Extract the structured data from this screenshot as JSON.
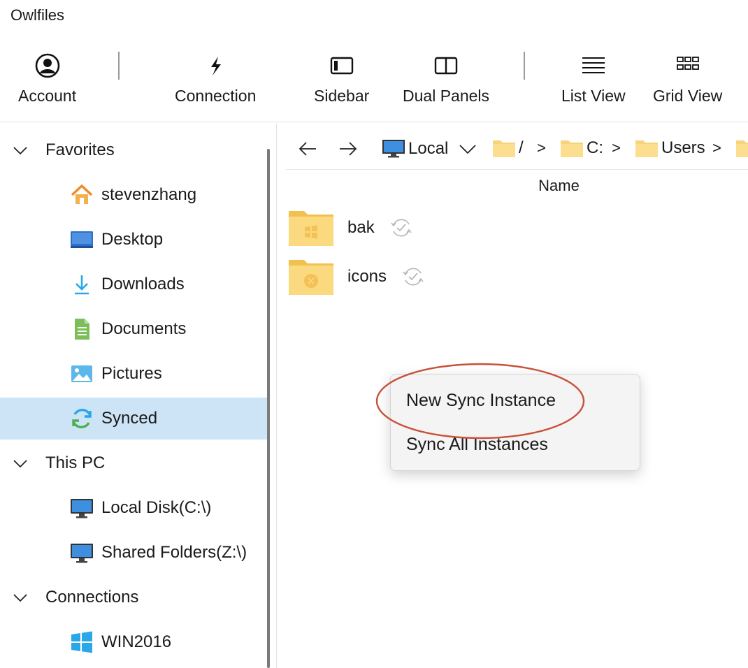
{
  "app": {
    "title": "Owlfiles"
  },
  "toolbar": {
    "account": "Account",
    "connection": "Connection",
    "sidebar": "Sidebar",
    "dual_panels": "Dual Panels",
    "list_view": "List View",
    "grid_view": "Grid View"
  },
  "sidebar": {
    "groups": [
      {
        "label": "Favorites",
        "items": [
          {
            "label": "stevenzhang",
            "icon": "home-icon"
          },
          {
            "label": "Desktop",
            "icon": "desktop-icon"
          },
          {
            "label": "Downloads",
            "icon": "download-icon"
          },
          {
            "label": "Documents",
            "icon": "document-icon"
          },
          {
            "label": "Pictures",
            "icon": "picture-icon"
          },
          {
            "label": "Synced",
            "icon": "sync-icon",
            "selected": true
          }
        ]
      },
      {
        "label": "This PC",
        "items": [
          {
            "label": "Local Disk(C:\\)",
            "icon": "monitor-icon"
          },
          {
            "label": "Shared Folders(Z:\\)",
            "icon": "monitor-icon"
          }
        ]
      },
      {
        "label": "Connections",
        "items": [
          {
            "label": "WIN2016",
            "icon": "windows-logo-icon"
          }
        ]
      }
    ]
  },
  "navbar": {
    "location": "Local",
    "crumbs": [
      "/",
      "C:",
      "Users"
    ],
    "separator": ">"
  },
  "file_list": {
    "column_name": "Name",
    "files": [
      {
        "name": "bak",
        "icon": "windows-folder-icon"
      },
      {
        "name": "icons",
        "icon": "x-folder-icon"
      }
    ]
  },
  "context_menu": {
    "items": [
      "New Sync Instance",
      "Sync All Instances"
    ]
  },
  "colors": {
    "selected_bg": "#cde4f7",
    "folder": "#f7d47a",
    "highlight_ring": "#c8503a",
    "windows_blue": "#2aa7e6"
  }
}
